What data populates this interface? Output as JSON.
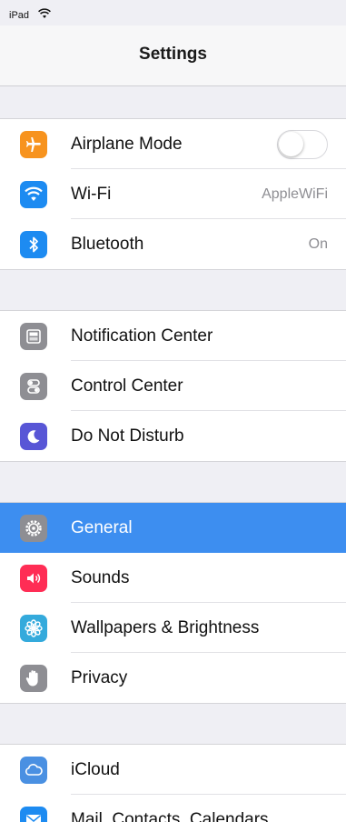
{
  "status_bar": {
    "carrier": "iPad",
    "wifi_icon": "wifi-icon"
  },
  "nav": {
    "title": "Settings"
  },
  "groups": [
    {
      "items": [
        {
          "label": "Airplane Mode",
          "icon": "airplane-icon",
          "icon_color": "#f7931e",
          "control": "toggle",
          "toggle_on": false
        },
        {
          "label": "Wi-Fi",
          "icon": "wifi-icon",
          "icon_color": "#1d8bf1",
          "detail": "AppleWiFi"
        },
        {
          "label": "Bluetooth",
          "icon": "bluetooth-icon",
          "icon_color": "#1d8bf1",
          "detail": "On"
        }
      ]
    },
    {
      "items": [
        {
          "label": "Notification Center",
          "icon": "notification-center-icon",
          "icon_color": "#8e8e93"
        },
        {
          "label": "Control Center",
          "icon": "control-center-icon",
          "icon_color": "#8e8e93"
        },
        {
          "label": "Do Not Disturb",
          "icon": "moon-icon",
          "icon_color": "#5856d6"
        }
      ]
    },
    {
      "items": [
        {
          "label": "General",
          "icon": "gear-icon",
          "icon_color": "#8e8e93",
          "selected": true,
          "selected_color": "#3d8ef0"
        },
        {
          "label": "Sounds",
          "icon": "speaker-icon",
          "icon_color": "#ff2d55"
        },
        {
          "label": "Wallpapers & Brightness",
          "icon": "flower-icon",
          "icon_color": "#34aadc"
        },
        {
          "label": "Privacy",
          "icon": "hand-icon",
          "icon_color": "#8e8e93"
        }
      ]
    },
    {
      "items": [
        {
          "label": "iCloud",
          "icon": "cloud-icon",
          "icon_color": "#4a90e2"
        },
        {
          "label": "Mail, Contacts, Calendars",
          "icon": "mail-icon",
          "icon_color": "#1d8bf1"
        }
      ]
    }
  ]
}
